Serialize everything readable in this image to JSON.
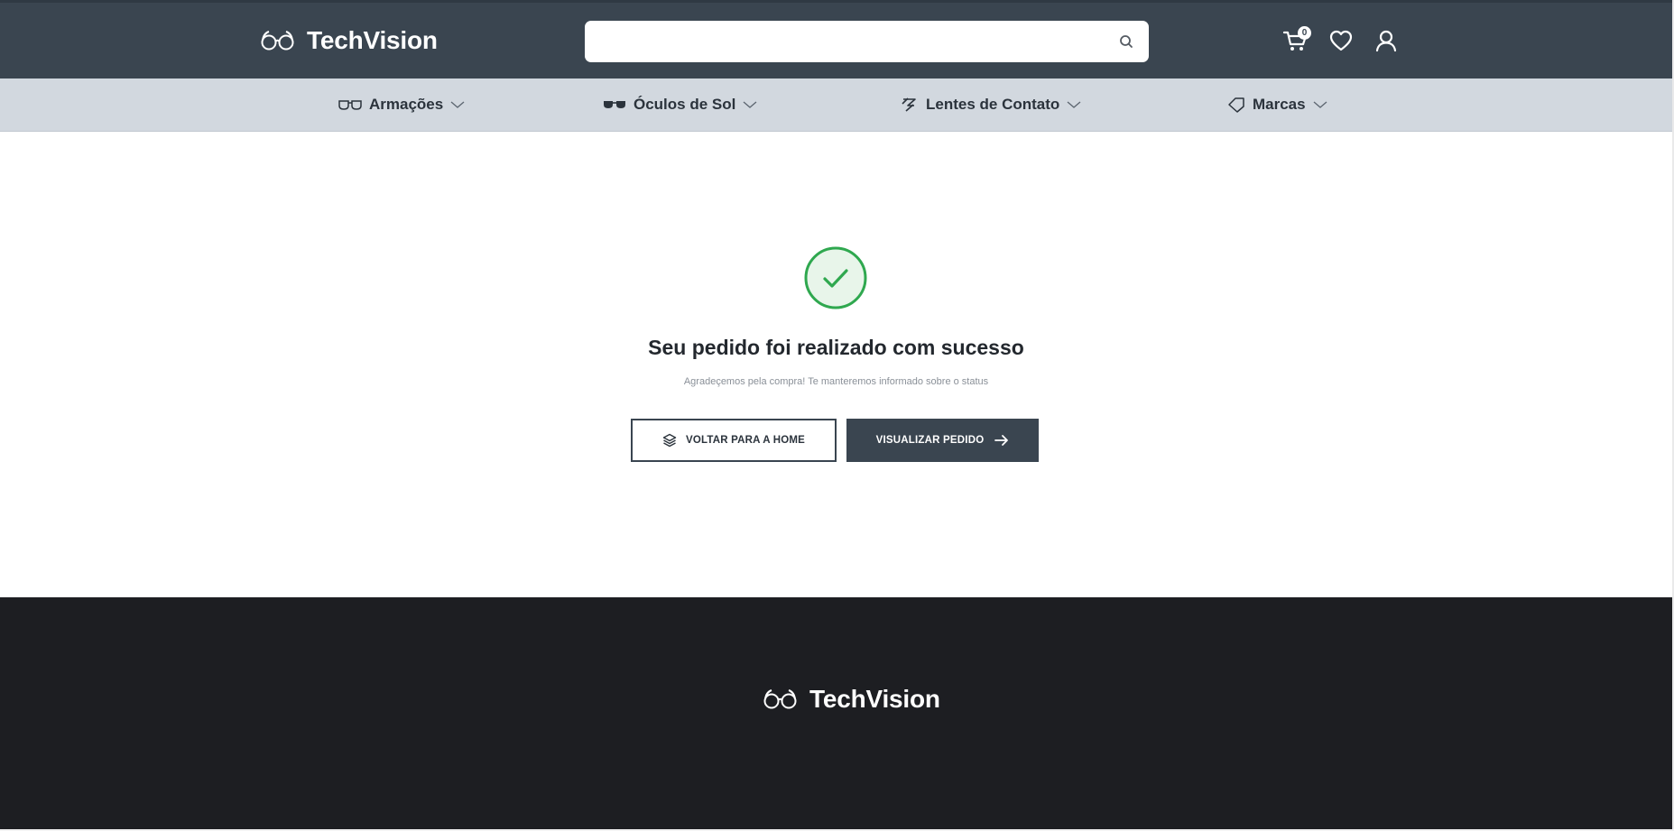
{
  "header": {
    "brand": "TechVision",
    "search": {
      "placeholder": "",
      "value": ""
    },
    "cart_count": "0",
    "icons": [
      "cart-icon",
      "heart-icon",
      "user-icon",
      "search-icon",
      "glasses-logo-icon"
    ]
  },
  "nav": {
    "items": [
      {
        "label": "Armações",
        "icon": "eyeglasses-icon"
      },
      {
        "label": "Óculos de Sol",
        "icon": "sunglasses-icon"
      },
      {
        "label": "Lentes de Contato",
        "icon": "contact-lens-icon"
      },
      {
        "label": "Marcas",
        "icon": "tag-icon"
      }
    ]
  },
  "main": {
    "title": "Seu pedido foi realizado com sucesso",
    "subtitle": "Agradeçemos pela compra! Te manteremos informado sobre o status",
    "home_button": "VOLTAR PARA A HOME",
    "view_order_button": "VISUALIZAR PEDIDO"
  },
  "footer": {
    "brand": "TechVision"
  },
  "colors": {
    "header_bg": "#3a4550",
    "nav_bg": "#d2d8df",
    "success_green": "#2fa84f",
    "success_green_fill": "#e8f5ea",
    "footer_bg": "#1d1e22",
    "primary_button": "#3a4550"
  }
}
